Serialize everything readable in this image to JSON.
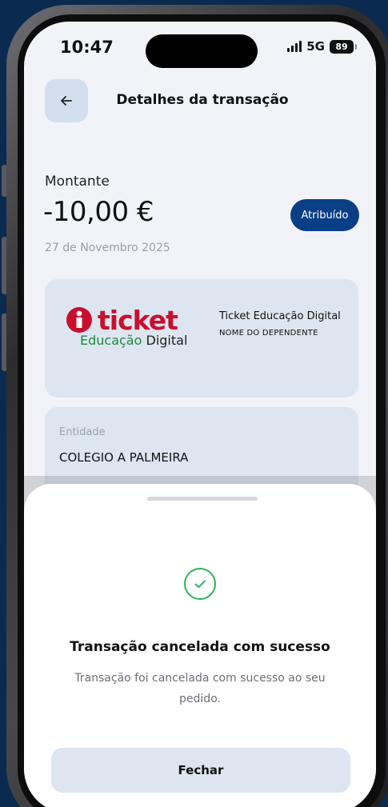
{
  "status_bar": {
    "time": "10:47",
    "network": "5G",
    "battery": "89"
  },
  "header": {
    "title": "Detalhes da transação",
    "back_icon": "arrow-left-icon"
  },
  "transaction": {
    "amount_label": "Montante",
    "amount": "-10,00 €",
    "status": "Atribuído",
    "date": "27 de Novembro 2025"
  },
  "benefit_card": {
    "logo": {
      "word": "ticket",
      "sub_green": "Educação",
      "sub_black": "Digital"
    },
    "name": "Ticket Educação Digital",
    "holder": "NOME DO DEPENDENTE"
  },
  "entity": {
    "label": "Entidade",
    "value": "COLEGIO A PALMEIRA"
  },
  "sheet": {
    "icon": "check-circle-icon",
    "title": "Transação cancelada com sucesso",
    "message": "Transação foi cancelada com sucesso ao seu pedido.",
    "close_label": "Fechar"
  },
  "colors": {
    "accent": "#0a3f86",
    "card": "#dde5f1",
    "success": "#2fb35a",
    "brand_red": "#c8102e",
    "brand_green": "#1f8a3b"
  }
}
